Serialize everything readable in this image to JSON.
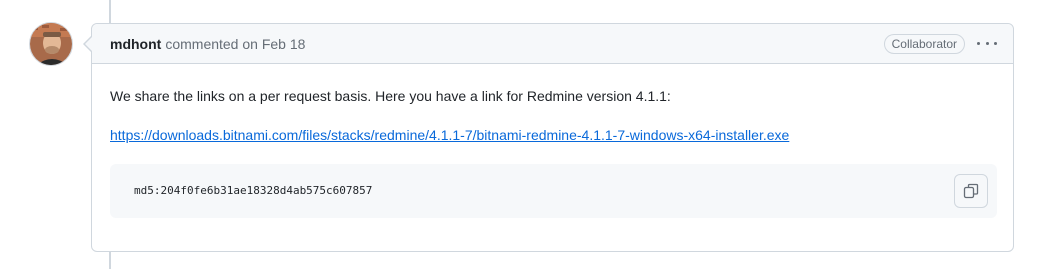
{
  "comment": {
    "author": "mdhont",
    "meta_text": "commented on Feb 18",
    "badge": "Collaborator",
    "body_text": "We share the links on a per request basis. Here you have a link for Redmine version 4.1.1:",
    "link_text": "https://downloads.bitnami.com/files/stacks/redmine/4.1.1-7/bitnami-redmine-4.1.1-7-windows-x64-installer.exe",
    "code_text": "md5:204f0fe6b31ae18328d4ab575c607857"
  },
  "icons": {
    "more": "kebab-horizontal-icon",
    "copy": "copy-icon"
  },
  "colors": {
    "link": "#0969da",
    "border": "#d0d7de",
    "header_bg": "#f6f8fa",
    "muted": "#656d76"
  }
}
